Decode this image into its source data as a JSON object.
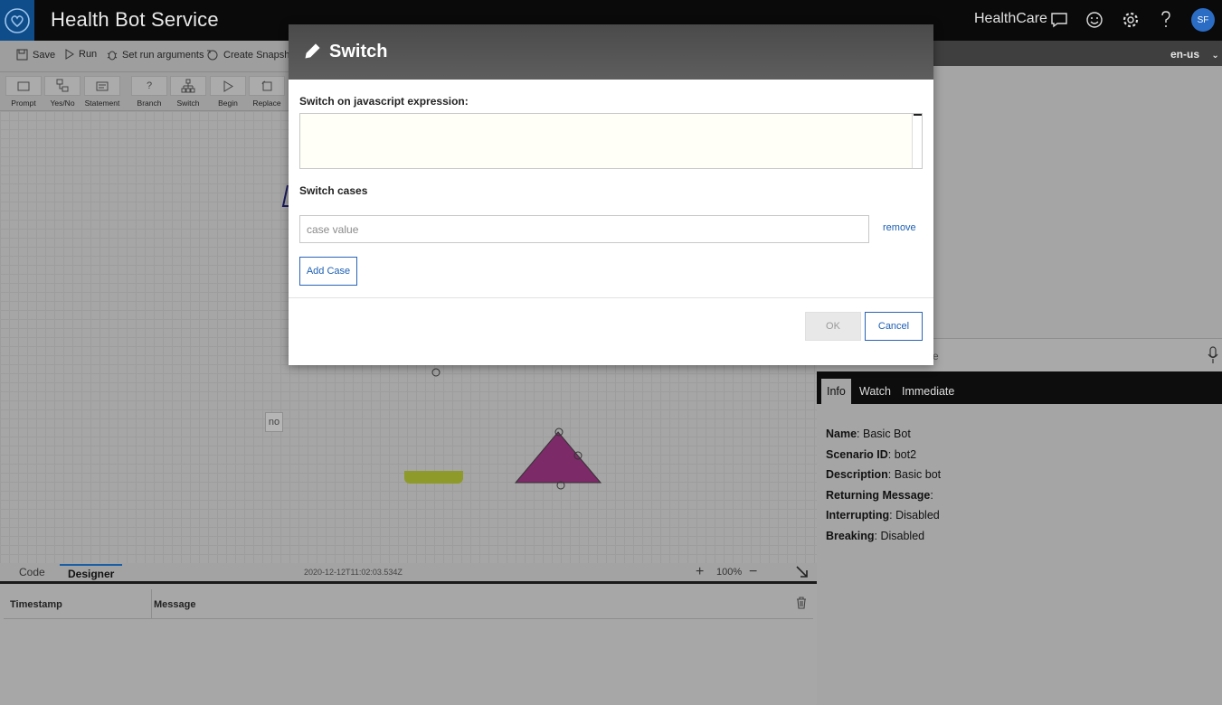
{
  "app": {
    "title": "Health Bot Service",
    "tenant": "HealthCare",
    "user_initials": "SF"
  },
  "header_icons": [
    "chat-icon",
    "smiley-icon",
    "gear-icon",
    "help-icon"
  ],
  "toolbar": {
    "save": "Save",
    "run": "Run",
    "set_run_args": "Set run arguments",
    "create_snapshot": "Create Snapshot"
  },
  "shapes": [
    {
      "label": "Prompt",
      "icon": "prompt-icon"
    },
    {
      "label": "Yes/No",
      "icon": "yes-no-icon"
    },
    {
      "label": "Statement",
      "icon": "statement-icon"
    },
    {
      "label": "Branch",
      "icon": "branch-icon"
    },
    {
      "label": "Switch",
      "icon": "switch-icon"
    },
    {
      "label": "Begin",
      "icon": "begin-icon"
    },
    {
      "label": "Replace",
      "icon": "replace-icon"
    }
  ],
  "canvas": {
    "no_label": "no",
    "triangle_color": "#8a1f6e"
  },
  "canvas_tabs": {
    "code": "Code",
    "designer": "Designer",
    "timestamp": "2020-12-12T11:02:03.534Z",
    "zoom": "100%"
  },
  "log": {
    "col_timestamp": "Timestamp",
    "col_message": "Message"
  },
  "right": {
    "language": "en-us",
    "chat_placeholder_fragment": "e",
    "tabs": {
      "info": "Info",
      "watch": "Watch",
      "immediate": "Immediate"
    },
    "info": {
      "name_label": "Name",
      "name_value": "Basic Bot",
      "scenario_label": "Scenario ID",
      "scenario_value": "bot2",
      "description_label": "Description",
      "description_value": "Basic bot",
      "returning_label": "Returning Message",
      "returning_value": "",
      "interrupting_label": "Interrupting",
      "interrupting_value": "Disabled",
      "breaking_label": "Breaking",
      "breaking_value": "Disabled"
    }
  },
  "modal": {
    "title": "Switch",
    "expression_label": "Switch on javascript expression:",
    "expression_value": "",
    "cases_label": "Switch cases",
    "case_placeholder": "case value",
    "remove": "remove",
    "add_case": "Add Case",
    "ok": "OK",
    "cancel": "Cancel"
  },
  "colors": {
    "accent": "#1c5fb3",
    "brand": "#0f4d8a"
  }
}
